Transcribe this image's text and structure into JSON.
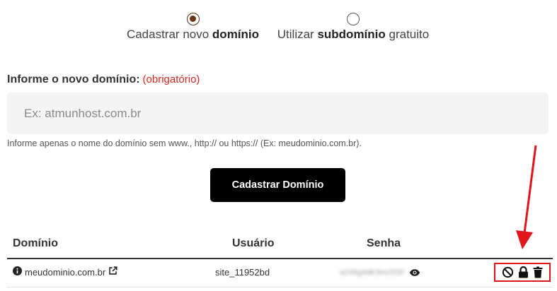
{
  "radio": {
    "new_prefix": "Cadastrar novo",
    "new_bold": "domínio",
    "sub_prefix": "Utilizar",
    "sub_bold": "subdomínio",
    "sub_suffix": "gratuito",
    "selected": "new"
  },
  "form": {
    "label": "Informe o novo domínio:",
    "required": "(obrigatório)",
    "placeholder": "Ex: atmunhost.com.br",
    "value": "",
    "help": "Informe apenas o nome do domínio sem www., http:// ou https:// (Ex: meudominio.com.br).",
    "submit_label": "Cadastrar Domínio"
  },
  "table": {
    "headers": [
      "Domínio",
      "Usuário",
      "Senha"
    ],
    "rows": [
      {
        "domain": "meudominio.com.br",
        "user": "site_11952bd",
        "password_masked": "a2Xkg4dK3mc5SF"
      }
    ]
  },
  "icons": {
    "info": "info-circle-icon",
    "external_link": "external-link-icon",
    "show_password": "eye-icon",
    "block": "ban-icon",
    "lock": "lock-icon",
    "delete": "trash-icon"
  },
  "colors": {
    "accent_red": "#e1151b",
    "radio_checked": "#6b3515",
    "button_bg": "#000000",
    "input_bg": "#f4f4f4"
  }
}
